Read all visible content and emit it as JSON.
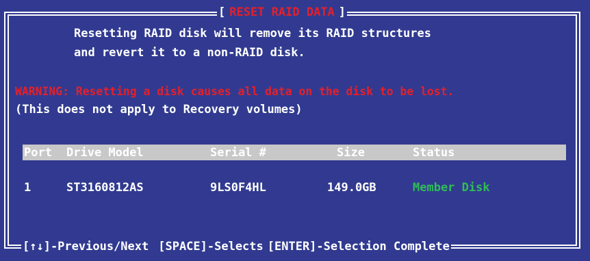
{
  "dialog": {
    "title_open": "[",
    "title": "RESET RAID DATA",
    "title_close": "]"
  },
  "message": {
    "line1": "Resetting RAID disk will remove its RAID structures",
    "line2": "and revert it to a non-RAID disk.",
    "warning": "WARNING: Resetting a disk causes all data on the disk to be lost.",
    "note": "(This does not apply to Recovery volumes)"
  },
  "table": {
    "columns": [
      "Port",
      "Drive Model",
      "Serial #",
      "Size",
      "Status"
    ],
    "rows": [
      {
        "port": "1",
        "model": "ST3160812AS",
        "serial": "9LS0F4HL",
        "size": "149.0GB",
        "status": "Member Disk"
      }
    ]
  },
  "footer": {
    "nav": "[↑↓]-Previous/Next",
    "select": "[SPACE]-Selects",
    "complete": "[ENTER]-Selection Complete"
  },
  "colors": {
    "background": "#313a90",
    "warning": "#e4202a",
    "status": "#2fbd55",
    "header_bar": "#c8c8c8"
  }
}
